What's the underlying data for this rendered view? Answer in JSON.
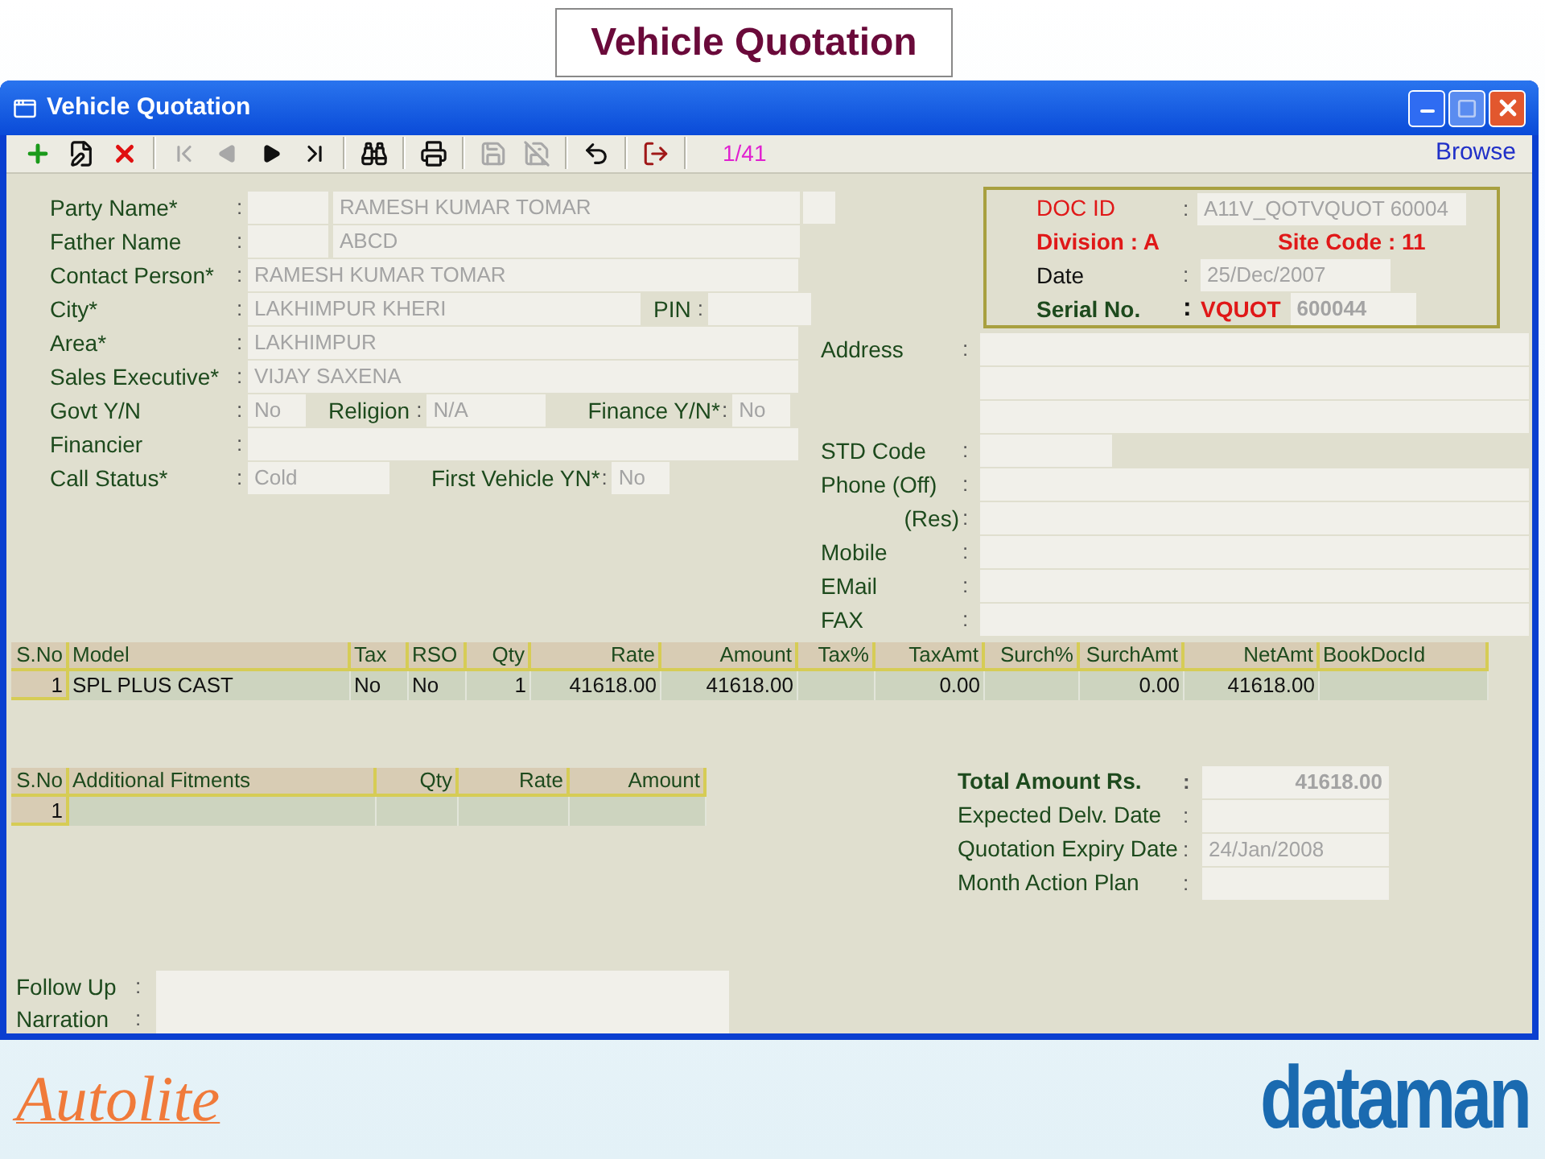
{
  "slide_title": "Vehicle Quotation",
  "window": {
    "title": "Vehicle Quotation"
  },
  "toolbar": {
    "buttons": [
      {
        "kind": "add",
        "disabled": false
      },
      {
        "kind": "edit",
        "disabled": false
      },
      {
        "kind": "delete",
        "disabled": false
      },
      {
        "kind": "first",
        "disabled": true
      },
      {
        "kind": "previous",
        "disabled": true
      },
      {
        "kind": "next",
        "disabled": false
      },
      {
        "kind": "last",
        "disabled": false
      },
      {
        "kind": "find",
        "disabled": false
      },
      {
        "kind": "print",
        "disabled": false
      },
      {
        "kind": "save",
        "disabled": true
      },
      {
        "kind": "cancel",
        "disabled": true
      },
      {
        "kind": "undo",
        "disabled": false
      },
      {
        "kind": "exit",
        "disabled": false
      }
    ],
    "record_counter": "1/41",
    "browse": "Browse"
  },
  "left_rows": [
    {
      "fields": [
        {
          "label": "Party Name*",
          "colon": ":",
          "value": "RAMESH KUMAR TOMAR",
          "prefix_box": true,
          "suffix_box": true,
          "kind": "wide"
        }
      ]
    },
    {
      "fields": [
        {
          "label": "Father Name",
          "colon": ":",
          "value": "ABCD",
          "prefix_box": true,
          "kind": "wide"
        }
      ]
    },
    {
      "fields": [
        {
          "label": "Contact Person*",
          "colon": ":",
          "value": "RAMESH KUMAR TOMAR",
          "kind": "full"
        }
      ]
    },
    {
      "fields": [
        {
          "label": "City*",
          "colon": ":",
          "value": "LAKHIMPUR KHERI",
          "kind": "city"
        },
        {
          "label": "PIN",
          "colon": ":",
          "kind": "pin"
        }
      ]
    },
    {
      "fields": [
        {
          "label": "Area*",
          "colon": ":",
          "value": "LAKHIMPUR",
          "kind": "full"
        }
      ]
    },
    {
      "fields": [
        {
          "label": "Sales Executive*",
          "colon": ":",
          "value": "VIJAY SAXENA",
          "kind": "full"
        }
      ]
    },
    {
      "fields": [
        {
          "label": "Govt Y/N",
          "colon": ":",
          "value": "No",
          "kind": "tiny"
        },
        {
          "label": "Religion",
          "colon": ":",
          "value": "N/A",
          "kind": "religion"
        },
        {
          "label": "Finance Y/N*",
          "colon": ":",
          "value": "No",
          "kind": "tiny"
        }
      ]
    },
    {
      "fields": [
        {
          "label": "Financier",
          "colon": ":",
          "kind": "full"
        }
      ]
    },
    {
      "fields": [
        {
          "label": "Call Status*",
          "colon": ":",
          "value": "Cold",
          "kind": "status"
        },
        {
          "label": "First Vehicle YN*",
          "colon": ":",
          "value": "No",
          "kind": "tiny"
        }
      ]
    }
  ],
  "doc_box": {
    "doc_id_label": "DOC ID",
    "doc_id_colon": ":",
    "doc_id": "A11V_QOTVQUOT  60004",
    "division": "Division : A",
    "site_code": "Site Code : 11",
    "date_label": "Date",
    "date_colon": ":",
    "date": "25/Dec/2007",
    "serial_label": "Serial No.",
    "serial_colon": ":",
    "serial_prefix": "VQUOT",
    "serial": "600044"
  },
  "right_rows": [
    {
      "label": "Address",
      "colon": ":",
      "kind": "multiline"
    },
    {
      "label": "STD Code",
      "colon": ":",
      "kind": "short"
    },
    {
      "label": "Phone (Off)",
      "colon": ":",
      "kind": "wide"
    },
    {
      "label": "(Res)",
      "colon": ":",
      "kind": "indented"
    },
    {
      "label": "Mobile",
      "colon": ":",
      "kind": "wide"
    },
    {
      "label": "EMail",
      "colon": ":",
      "kind": "wide"
    },
    {
      "label": "FAX",
      "colon": ":",
      "kind": "wide"
    }
  ],
  "model_grid": {
    "columns": [
      "S.No",
      "Model",
      "Tax",
      "RSO",
      "Qty",
      "Rate",
      "Amount",
      "Tax%",
      "TaxAmt",
      "Surch%",
      "SurchAmt",
      "NetAmt",
      "BookDocId"
    ],
    "rows": [
      [
        "1",
        "SPL PLUS CAST",
        "No",
        "No",
        "1",
        "41618.00",
        "41618.00",
        "",
        "0.00",
        "",
        "0.00",
        "41618.00",
        ""
      ]
    ]
  },
  "fitments_grid": {
    "columns": [
      "S.No",
      "Additional Fitments",
      "Qty",
      "Rate",
      "Amount"
    ],
    "rows": [
      [
        "1",
        "",
        "",
        "",
        ""
      ]
    ]
  },
  "totals": [
    {
      "label": "Total Amount Rs.",
      "colon": ":",
      "value": "41618.00",
      "kind": "total"
    },
    {
      "label": "Expected Delv.  Date",
      "colon": ":",
      "kind": "plain"
    },
    {
      "label": "Quotation Expiry Date",
      "colon": ":",
      "value": "24/Jan/2008",
      "kind": "plain"
    },
    {
      "label": "Month Action Plan",
      "colon": ":",
      "kind": "plain"
    }
  ],
  "notes": [
    {
      "label": "Follow Up",
      "colon": ":",
      "kind": "single"
    },
    {
      "label": "Narration",
      "colon": ":",
      "kind": "double"
    }
  ],
  "footer": {
    "left_logo": "Autolite",
    "right_logo": "dataman"
  }
}
